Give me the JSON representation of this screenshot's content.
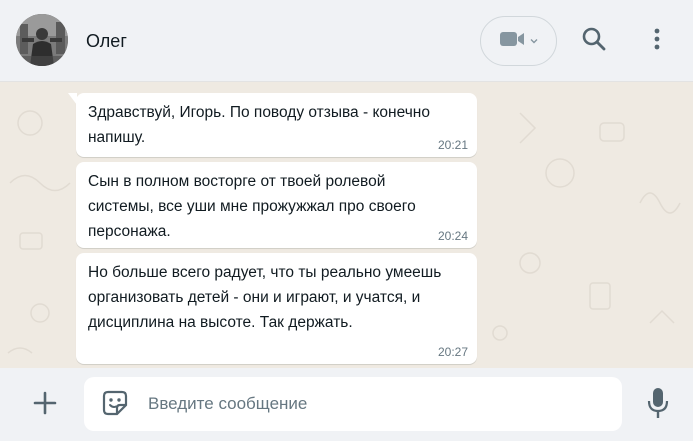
{
  "header": {
    "contact_name": "Олег",
    "icons": {
      "avatar": "contact-avatar",
      "video": "video-camera-icon",
      "dropdown": "chevron-down-icon",
      "search": "search-icon",
      "menu": "more-vertical-icon"
    }
  },
  "messages": [
    {
      "text": "Здравствуй, Игорь. По поводу отзыва - конечно напишу.",
      "time": "20:21",
      "first": true
    },
    {
      "text": "Сын в полном восторге от твоей ролевой системы, все уши мне прожужжал про своего персонажа.",
      "time": "20:24",
      "first": false
    },
    {
      "text": "Но больше всего радует, что ты реально умеешь организовать детей - они и играют, и учатся, и дисциплина на высоте. Так держать.",
      "time": "20:27",
      "first": false
    }
  ],
  "footer": {
    "input_placeholder": "Введите сообщение",
    "input_value": "",
    "icons": {
      "attach": "plus-icon",
      "sticker": "sticker-icon",
      "mic": "microphone-icon"
    }
  },
  "colors": {
    "header_bg": "#f0f2f5",
    "chat_bg": "#efeae2",
    "bubble_bg": "#ffffff",
    "text": "#111b21",
    "meta_text": "#667781",
    "icon": "#54656f"
  }
}
